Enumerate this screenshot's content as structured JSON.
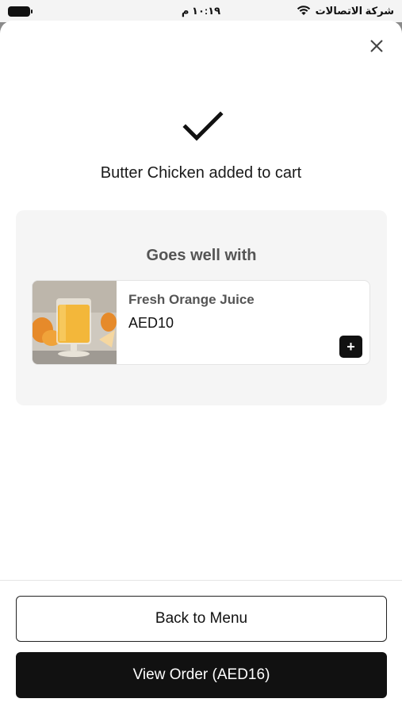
{
  "status_bar": {
    "carrier": "شركة الاتصالات",
    "time": "١٠:١٩ م",
    "icons": [
      "wifi-icon",
      "battery-icon"
    ]
  },
  "sheet": {
    "close_icon": "close-icon",
    "success_icon": "checkmark-icon",
    "confirmation_text": "Butter Chicken added to cart"
  },
  "upsell": {
    "title": "Goes well with",
    "items": [
      {
        "name": "Fresh Orange Juice",
        "price": "AED10",
        "add_label": "+",
        "image": "orange-juice-photo"
      }
    ]
  },
  "actions": {
    "back_label": "Back to Menu",
    "view_order_label": "View Order (AED16)"
  },
  "colors": {
    "primary": "#111111",
    "card_bg": "#f5f5f5",
    "juice": "#f3b73a"
  }
}
